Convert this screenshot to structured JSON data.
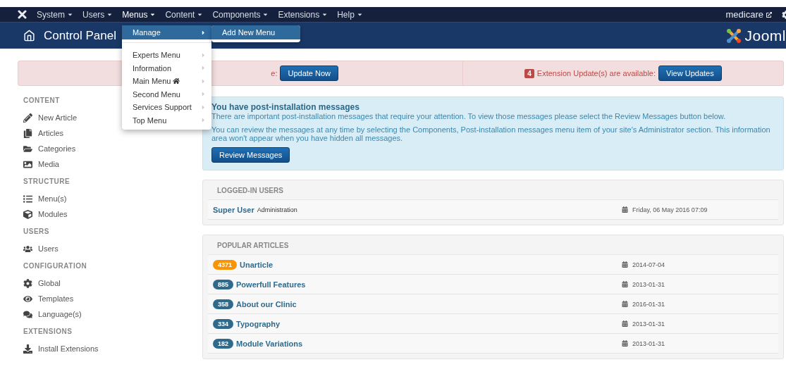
{
  "navbar": {
    "items": [
      {
        "label": "System",
        "selected": false
      },
      {
        "label": "Users",
        "selected": false
      },
      {
        "label": "Menus",
        "selected": true
      },
      {
        "label": "Content",
        "selected": false
      },
      {
        "label": "Components",
        "selected": false
      },
      {
        "label": "Extensions",
        "selected": false
      },
      {
        "label": "Help",
        "selected": false
      }
    ],
    "site_link": "medicare"
  },
  "header": {
    "title": "Control Panel",
    "logo_text": "Jooml"
  },
  "menus_dropdown": {
    "items": [
      {
        "label": "Manage",
        "selected": true,
        "default": false
      },
      {
        "label": "Experts Menu",
        "selected": false,
        "default": false
      },
      {
        "label": "Information",
        "selected": false,
        "default": false
      },
      {
        "label": "Main Menu",
        "selected": false,
        "default": true
      },
      {
        "label": "Second Menu",
        "selected": false,
        "default": false
      },
      {
        "label": "Services Support",
        "selected": false,
        "default": false
      },
      {
        "label": "Top Menu",
        "selected": false,
        "default": false
      }
    ],
    "submenu": {
      "items": [
        {
          "label": "Add New Menu",
          "selected": true
        }
      ]
    }
  },
  "update_alert": {
    "core_text_tail": "e:",
    "core_button": "Update Now",
    "extension_count": "4",
    "extension_text": "Extension Update(s) are available:",
    "extension_button": "View Updates"
  },
  "sidebar": {
    "sections": [
      {
        "title": "CONTENT",
        "items": [
          "New Article",
          "Articles",
          "Categories",
          "Media"
        ]
      },
      {
        "title": "STRUCTURE",
        "items": [
          "Menu(s)",
          "Modules"
        ]
      },
      {
        "title": "USERS",
        "items": [
          "Users"
        ]
      },
      {
        "title": "CONFIGURATION",
        "items": [
          "Global",
          "Templates",
          "Language(s)"
        ]
      },
      {
        "title": "EXTENSIONS",
        "items": [
          "Install Extensions"
        ]
      }
    ]
  },
  "postinstall": {
    "title": "You have post-installation messages",
    "text_1": "There are important post-installation messages that require your attention. To view those messages please select the Review Messages button below.",
    "text_2": "You can review the messages at any time by selecting the Components, Post-installation messages menu item of your site's Administrator section. This information area won't appear when you have hidden all messages.",
    "button": "Review Messages"
  },
  "logged_in_users": {
    "title": "LOGGED-IN USERS",
    "rows": [
      {
        "name": "Super User",
        "area": "Administration",
        "date": "Friday, 06 May 2016 07:09"
      }
    ]
  },
  "popular_articles": {
    "title": "POPULAR ARTICLES",
    "rows": [
      {
        "hits": "4371",
        "title": "Unarticle",
        "date": "2014-07-04",
        "color": "#f89406"
      },
      {
        "hits": "885",
        "title": "Powerfull Features",
        "date": "2013-01-31",
        "color": "#2f6a8d"
      },
      {
        "hits": "358",
        "title": "About our Clinic",
        "date": "2016-01-31",
        "color": "#2f6a8d"
      },
      {
        "hits": "334",
        "title": "Typography",
        "date": "2013-01-31",
        "color": "#2f6a8d"
      },
      {
        "hits": "182",
        "title": "Module Variations",
        "date": "2013-01-31",
        "color": "#2f6a8d"
      }
    ]
  }
}
